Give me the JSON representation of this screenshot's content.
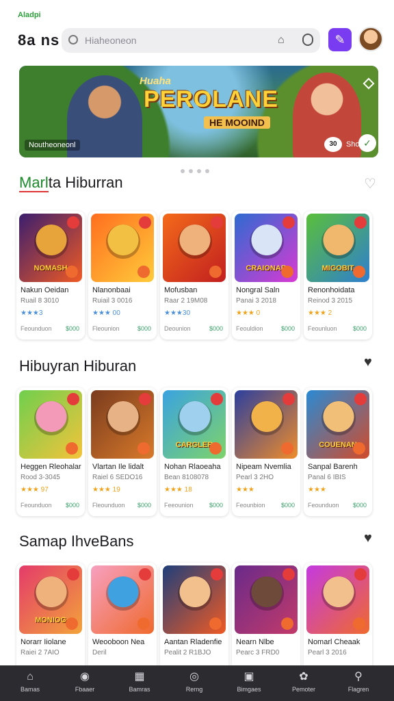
{
  "status": {
    "label": "Aladpi"
  },
  "header": {
    "brand": "8a ns",
    "search_placeholder": "Hiaheoneon",
    "icons": [
      "search-icon",
      "bell-icon",
      "mic-icon",
      "wand-icon"
    ]
  },
  "banner": {
    "small_title": "Huaha",
    "title": "PEROLANE",
    "subtitle": "HE MOOIND",
    "credit": "Noutheoneonl",
    "pill": "30",
    "pill_text": "Sholoo"
  },
  "sections": [
    {
      "title_first": "Marl",
      "title_rest": "ta Hiburran",
      "heart": "outline",
      "cards": [
        {
          "name": "Nakun Oeidan",
          "meta": "Ruail 8 3010",
          "rating": "★★★3",
          "foot": "Feounduon",
          "price": "$000",
          "word": "NOMASH",
          "color1": "#3b1e6e",
          "color2": "#ef5a24",
          "face": "#e6a43a"
        },
        {
          "name": "Nlanonbaai",
          "meta": "Ruiail 3 0016",
          "rating": "★★★ 00",
          "foot": "Fleounion",
          "price": "$000",
          "word": "",
          "color1": "#ff6e1f",
          "color2": "#ffcb3a",
          "face": "#f2c042"
        },
        {
          "name": "Mofusban",
          "meta": "Raar 2 19M08",
          "rating": "★★★30",
          "foot": "Deounion",
          "price": "$000",
          "word": "",
          "color1": "#f36a1a",
          "color2": "#c21f1f",
          "face": "#efb27d"
        },
        {
          "name": "Nongral Saln",
          "meta": "Panai 3 2018",
          "rating": "★★★ 0",
          "foot": "Feouldion",
          "price": "$000",
          "word": "CRAIONAR",
          "color1": "#2e6bd1",
          "color2": "#d83ad3",
          "face": "#d9e4f7"
        },
        {
          "name": "Renonhoidata",
          "meta": "Reinod 3 2015",
          "rating": "★★★ 2",
          "foot": "Feounluon",
          "price": "$000",
          "word": "MIGOBIT",
          "color1": "#5abf3a",
          "color2": "#2f7fcf",
          "face": "#f0b86d"
        }
      ]
    },
    {
      "title_first": "",
      "title_rest": "Hibuyran Hiburan",
      "heart": "filled",
      "cards": [
        {
          "name": "Heggen Rleohalar",
          "meta": "Rood 3-3045",
          "rating": "★★★ 97",
          "foot": "Feounduon",
          "price": "$000",
          "word": "",
          "color1": "#6fcf4e",
          "color2": "#f4c33a",
          "face": "#f29ab8"
        },
        {
          "name": "Vlartan Ile lidalt",
          "meta": "Raiel 6 SEDO16",
          "rating": "★★★ 19",
          "foot": "Fleounduon",
          "price": "$000",
          "word": "",
          "color1": "#7a3b1e",
          "color2": "#d87a2a",
          "face": "#e7b285"
        },
        {
          "name": "Nohan Rlaoeaha",
          "meta": "Bean 8108078",
          "rating": "★★★ 18",
          "foot": "Feeounion",
          "price": "$000",
          "word": "CARGLER",
          "color1": "#3aa3e0",
          "color2": "#7ed36a",
          "face": "#9fd1ef"
        },
        {
          "name": "Nipeam Nvemlia",
          "meta": "Pearl 3 2HO",
          "rating": "★★★",
          "foot": "Feounbion",
          "price": "$000",
          "word": "",
          "color1": "#2c3f9e",
          "color2": "#ef8c2a",
          "face": "#f1b24a"
        },
        {
          "name": "Sanpal Barenh",
          "meta": "Panal 6 IBIS",
          "rating": "★★★",
          "foot": "Feounduon",
          "price": "$000",
          "word": "COUENAN",
          "color1": "#2a8ad4",
          "color2": "#d14b2a",
          "face": "#f2bf78"
        }
      ]
    },
    {
      "title_first": "",
      "title_rest": "Samap IhveBans",
      "heart": "filled",
      "cards": [
        {
          "name": "Norarr Iiolane",
          "meta": "Raiei 2 7AIO",
          "rating": "",
          "foot": "",
          "price": "",
          "word": "MONIOG",
          "color1": "#e43b6a",
          "color2": "#f2a33a",
          "face": "#f0b27d"
        },
        {
          "name": "Weooboon Nea",
          "meta": "Deril",
          "rating": "",
          "foot": "",
          "price": "",
          "word": "",
          "color1": "#f7a0c0",
          "color2": "#ef6a2e",
          "face": "#3fa1e0"
        },
        {
          "name": "Aantan Rladenfie",
          "meta": "Pealit 2 R1BJO",
          "rating": "",
          "foot": "",
          "price": "",
          "word": "",
          "color1": "#1f3f7a",
          "color2": "#ef5a24",
          "face": "#f1c08c"
        },
        {
          "name": "Nearn Nlbe",
          "meta": "Pearc 3 FRD0",
          "rating": "",
          "foot": "",
          "price": "",
          "word": "",
          "color1": "#6a2a8a",
          "color2": "#c23a6a",
          "face": "#6e4a3a"
        },
        {
          "name": "Nomarl Cheaak",
          "meta": "Pearl 3 2016",
          "rating": "",
          "foot": "",
          "price": "",
          "word": "",
          "color1": "#c43ae0",
          "color2": "#ef6a2e",
          "face": "#f1c08c"
        }
      ]
    }
  ],
  "bottom_nav": [
    {
      "label": "Bamas",
      "icon": "home-icon"
    },
    {
      "label": "Fbaaer",
      "icon": "explore-icon"
    },
    {
      "label": "Bamras",
      "icon": "library-icon"
    },
    {
      "label": "Rerng",
      "icon": "play-icon"
    },
    {
      "label": "Bimgaes",
      "icon": "games-icon"
    },
    {
      "label": "Pemoter",
      "icon": "settings-icon"
    },
    {
      "label": "Flagren",
      "icon": "search-icon"
    }
  ]
}
